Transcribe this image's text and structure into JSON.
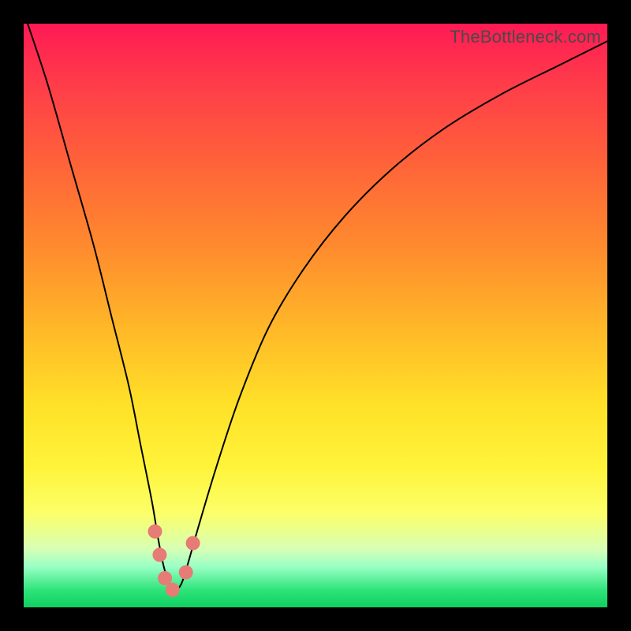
{
  "watermark": "TheBottleneck.com",
  "chart_data": {
    "type": "line",
    "title": "",
    "xlabel": "",
    "ylabel": "",
    "xlim": [
      0,
      100
    ],
    "ylim": [
      0,
      100
    ],
    "series": [
      {
        "name": "bottleneck-curve",
        "x": [
          0,
          4,
          8,
          12,
          15,
          18,
          20,
          22,
          23,
          24,
          25,
          26,
          27,
          28,
          30,
          33,
          37,
          42,
          48,
          55,
          63,
          72,
          82,
          92,
          100
        ],
        "values": [
          102,
          90,
          76,
          62,
          50,
          38,
          28,
          18,
          12,
          7,
          4,
          3,
          4,
          7,
          14,
          24,
          36,
          48,
          58,
          67,
          75,
          82,
          88,
          93,
          97
        ]
      }
    ],
    "markers": [
      {
        "x": 22.5,
        "y": 13
      },
      {
        "x": 23.3,
        "y": 9
      },
      {
        "x": 24.2,
        "y": 5
      },
      {
        "x": 25.5,
        "y": 3
      },
      {
        "x": 27.8,
        "y": 6
      },
      {
        "x": 29.0,
        "y": 11
      }
    ],
    "gradient_stops": [
      {
        "pos": 0,
        "color": "#ff1a54"
      },
      {
        "pos": 25,
        "color": "#ff6638"
      },
      {
        "pos": 52,
        "color": "#ffb728"
      },
      {
        "pos": 76,
        "color": "#fff43a"
      },
      {
        "pos": 93,
        "color": "#9affc6"
      },
      {
        "pos": 100,
        "color": "#0ed060"
      }
    ]
  }
}
